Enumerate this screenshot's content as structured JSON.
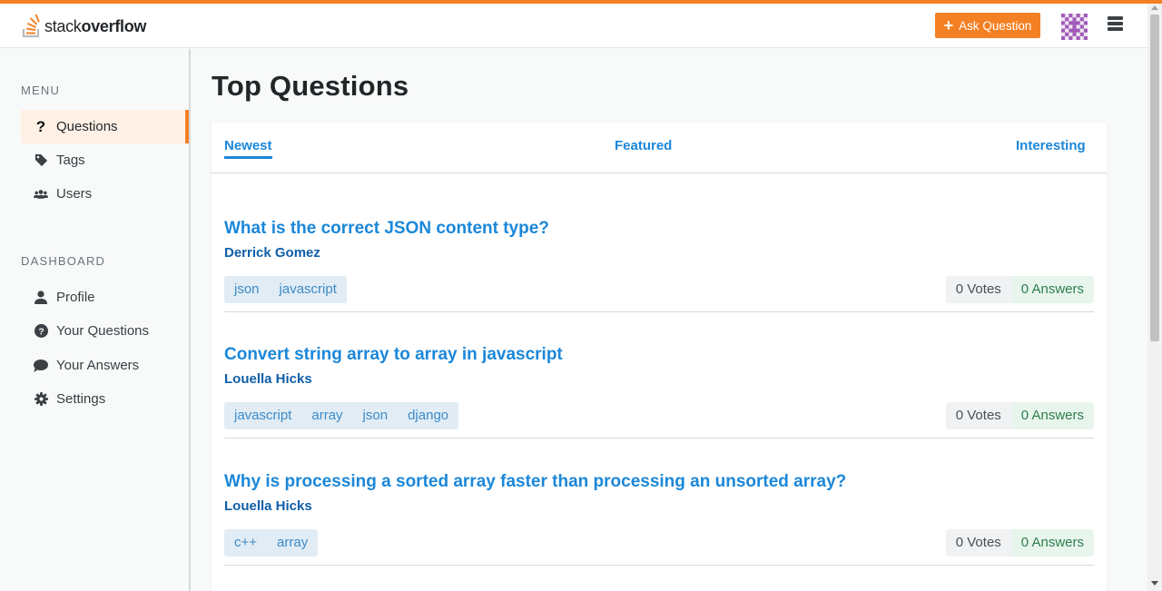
{
  "header": {
    "logo_light": "stack",
    "logo_bold": "overflow",
    "ask_button_label": "Ask Question",
    "accent_color": "#f48024"
  },
  "sidebar": {
    "menu_heading": "MENU",
    "menu_items": [
      {
        "label": "Questions",
        "icon": "question-mark-icon",
        "active": true
      },
      {
        "label": "Tags",
        "icon": "tag-icon",
        "active": false
      },
      {
        "label": "Users",
        "icon": "users-icon",
        "active": false
      }
    ],
    "dashboard_heading": "DASHBOARD",
    "dashboard_items": [
      {
        "label": "Profile",
        "icon": "user-icon"
      },
      {
        "label": "Your Questions",
        "icon": "question-circle-icon"
      },
      {
        "label": "Your Answers",
        "icon": "comment-icon"
      },
      {
        "label": "Settings",
        "icon": "gear-icon"
      }
    ]
  },
  "main": {
    "title": "Top Questions",
    "tabs": [
      {
        "label": "Newest",
        "active": true
      },
      {
        "label": "Featured",
        "active": false
      },
      {
        "label": "Interesting",
        "active": false
      }
    ],
    "questions": [
      {
        "title": "What is the correct JSON content type?",
        "author": "Derrick Gomez",
        "tags": [
          "json",
          "javascript"
        ],
        "votes": "0 Votes",
        "answers": "0 Answers"
      },
      {
        "title": "Convert string array to array in javascript",
        "author": "Louella Hicks",
        "tags": [
          "javascript",
          "array",
          "json",
          "django"
        ],
        "votes": "0 Votes",
        "answers": "0 Answers"
      },
      {
        "title": "Why is processing a sorted array faster than processing an unsorted array?",
        "author": "Louella Hicks",
        "tags": [
          "c++",
          "array"
        ],
        "votes": "0 Votes",
        "answers": "0 Answers"
      }
    ]
  }
}
